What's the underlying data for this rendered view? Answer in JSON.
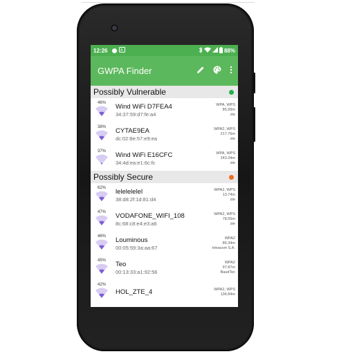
{
  "status": {
    "time": "12:26",
    "battery": "88%"
  },
  "app": {
    "title": "GWPA Finder",
    "edit_icon": "pencil-icon",
    "palette_icon": "palette-icon",
    "more_icon": "more-vert-icon"
  },
  "sections": [
    {
      "title": "Possibly Vulnerable",
      "color": "#22b14c"
    },
    {
      "title": "Possibly Secure",
      "color": "#f26b1d"
    }
  ],
  "networks_vulnerable": [
    {
      "pct": "46%",
      "ssid": "Wind WiFi D7FEA4",
      "mac": "34:37:59:d7:fe:a4",
      "security": "WPA, WPS",
      "distance": "85.99m",
      "vendor": "zte",
      "level": 0.46
    },
    {
      "pct": "38%",
      "ssid": "CYTAE9EA",
      "mac": "dc:02:8e:57:e9:ea",
      "security": "WPA2, WPS",
      "distance": "217.76m",
      "vendor": "zte",
      "level": 0.38
    },
    {
      "pct": "37%",
      "ssid": "Wind WiFi E16CFC",
      "mac": "34:4d:ea:e1:6c:fc",
      "security": "WPA, WPS",
      "distance": "243.34m",
      "vendor": "zte",
      "level": 0.37
    }
  ],
  "networks_secure": [
    {
      "pct": "62%",
      "ssid": "lelelelelel",
      "mac": "38:d8:2f:1d:81:d4",
      "security": "WPA2, WPS",
      "distance": "13.74m",
      "vendor": "zte",
      "level": 0.62
    },
    {
      "pct": "47%",
      "ssid": "VODAFONE_WIFI_108",
      "mac": "8c:68:c8:e4:e3:a6",
      "security": "WPA2, WPS",
      "distance": "78.55m",
      "vendor": "zte",
      "level": 0.47
    },
    {
      "pct": "46%",
      "ssid": "Louminous",
      "mac": "00:05:59:3a:aa:67",
      "security": "WPA2",
      "distance": "86.34m",
      "vendor": "Intracom S.A.",
      "level": 0.46
    },
    {
      "pct": "45%",
      "ssid": "Teo",
      "mac": "00:13:33:a1:92:56",
      "security": "WPA2",
      "distance": "97.87m",
      "vendor": "BaudTec",
      "level": 0.45
    },
    {
      "pct": "42%",
      "ssid": "HOL_ZTE_4",
      "mac": "",
      "security": "WPA2, WPS",
      "distance": "136.84m",
      "vendor": "",
      "level": 0.42
    }
  ],
  "colors": {
    "statusbar": "#4caf50",
    "appbar": "#5cb85c",
    "wifi_full": "#7b5cd6",
    "wifi_empty": "#d7ccf3"
  }
}
